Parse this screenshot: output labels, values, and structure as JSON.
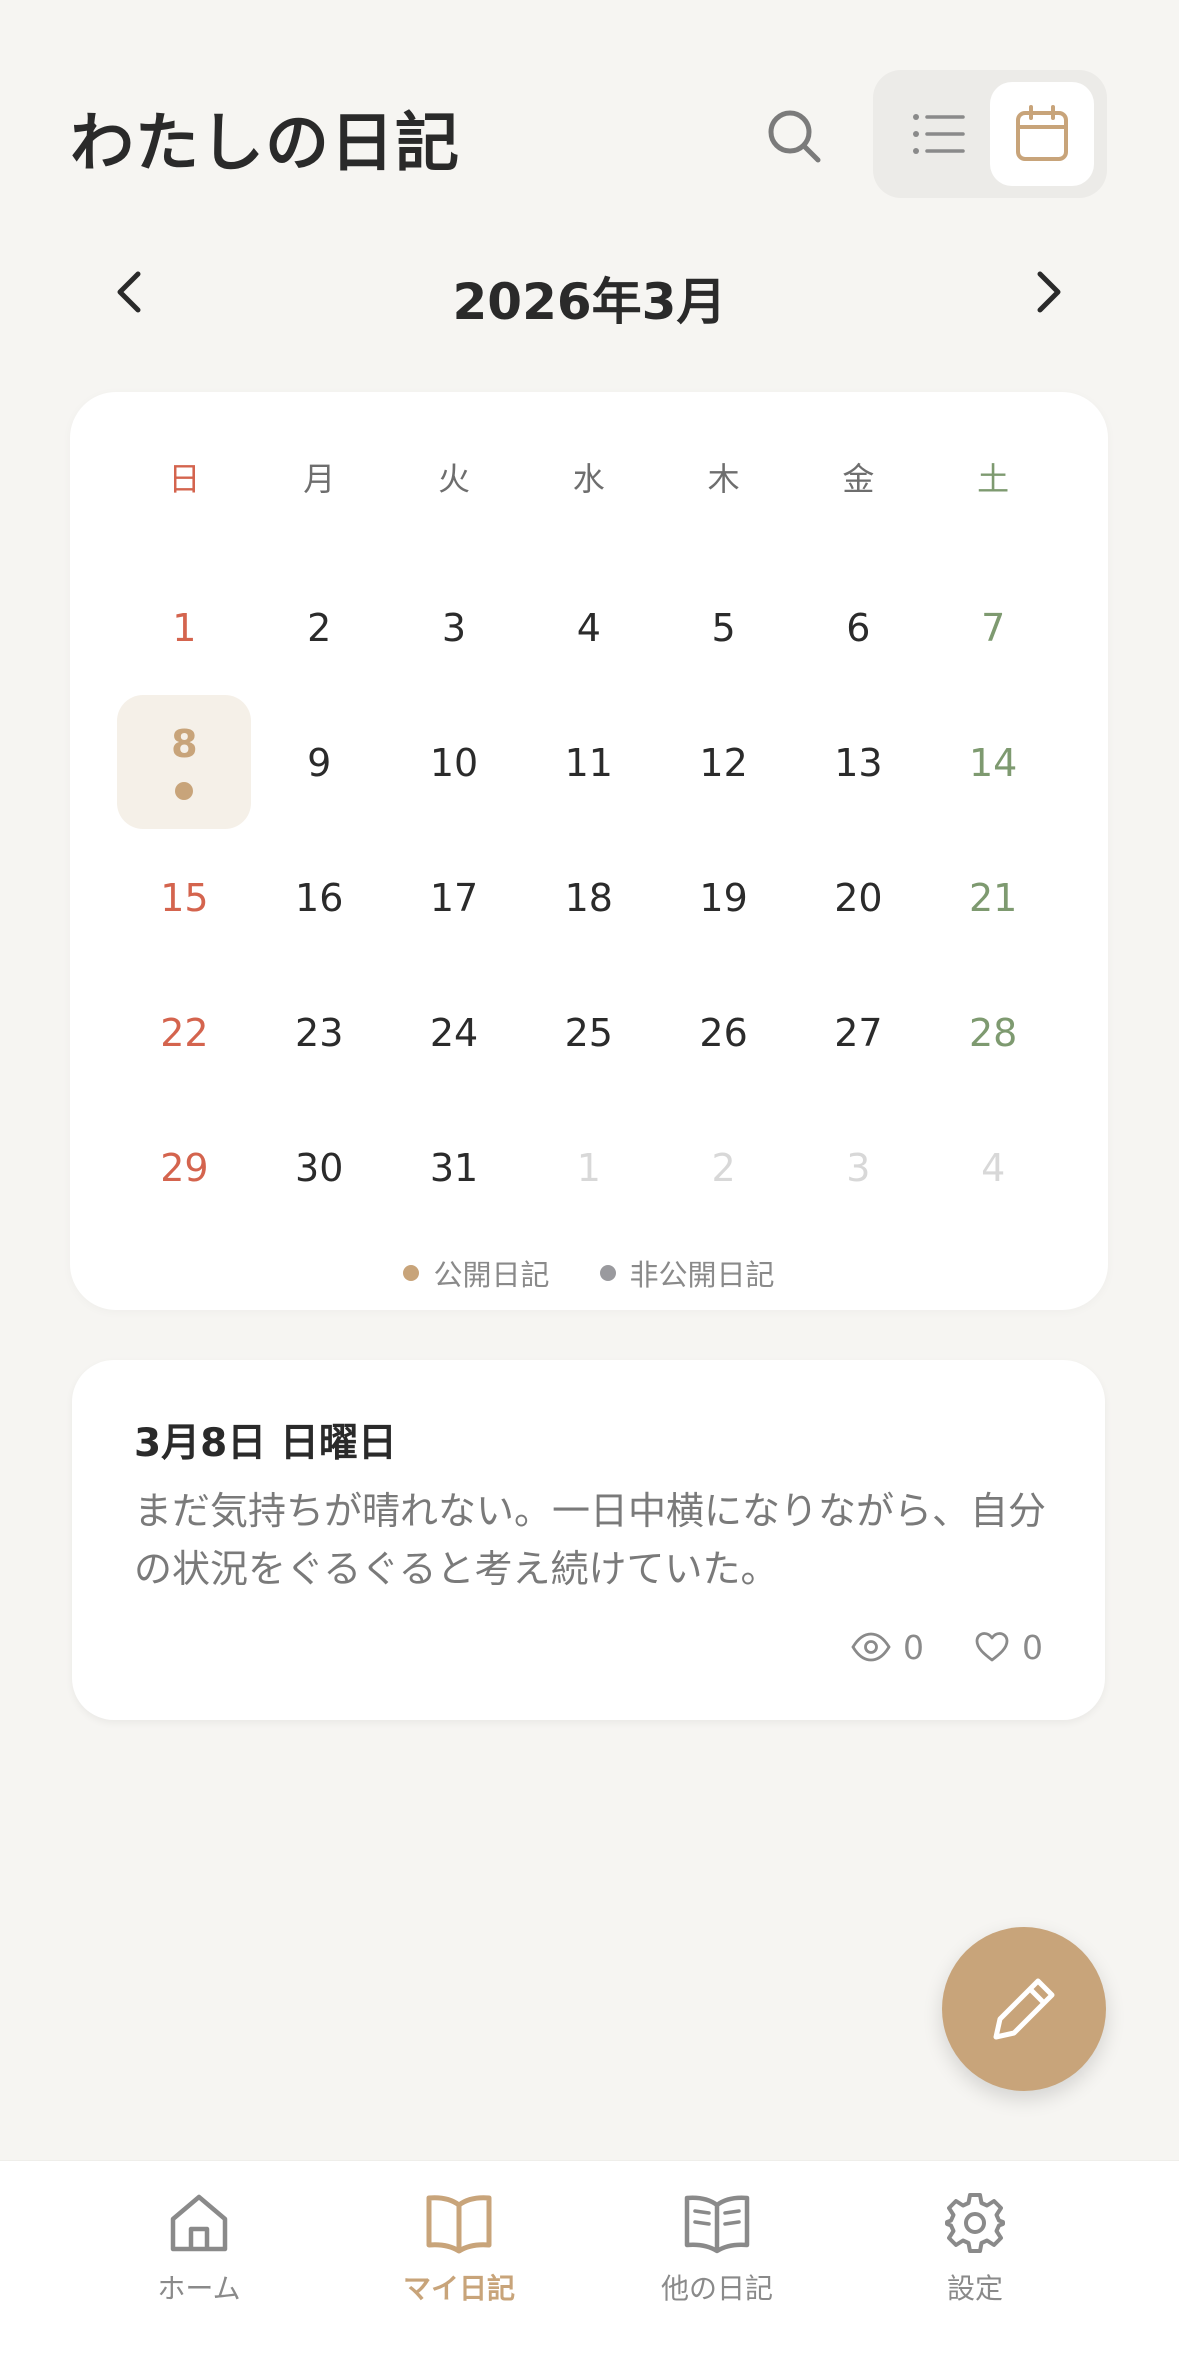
{
  "header": {
    "title": "わたしの日記",
    "search_icon": "search-icon",
    "view_toggle": {
      "list_icon": "list-icon",
      "calendar_icon": "calendar-icon",
      "active": "calendar"
    }
  },
  "month_nav": {
    "label": "2026年3月",
    "prev_icon": "chevron-left-icon",
    "next_icon": "chevron-right-icon"
  },
  "calendar": {
    "weekdays": [
      "日",
      "月",
      "火",
      "水",
      "木",
      "金",
      "土"
    ],
    "weeks": [
      [
        "1",
        "2",
        "3",
        "4",
        "5",
        "6",
        "7"
      ],
      [
        "8",
        "9",
        "10",
        "11",
        "12",
        "13",
        "14"
      ],
      [
        "15",
        "16",
        "17",
        "18",
        "19",
        "20",
        "21"
      ],
      [
        "22",
        "23",
        "24",
        "25",
        "26",
        "27",
        "28"
      ],
      [
        "29",
        "30",
        "31",
        "1",
        "2",
        "3",
        "4"
      ]
    ],
    "selected_day": "8",
    "days_with_public_entries": [
      "8"
    ],
    "legend": {
      "public_label": "公開日記",
      "private_label": "非公開日記"
    }
  },
  "entry": {
    "date": "3月8日 日曜日",
    "text": "まだ気持ちが晴れない。一日中横になりながら、自分の状況をぐるぐると考え続けていた。",
    "views": "0",
    "likes": "0"
  },
  "fab": {
    "icon": "pencil-icon"
  },
  "bottom_nav": {
    "items": [
      {
        "label": "ホーム",
        "icon": "home-icon"
      },
      {
        "label": "マイ日記",
        "icon": "book-open-icon"
      },
      {
        "label": "他の日記",
        "icon": "book-open-lines-icon"
      },
      {
        "label": "設定",
        "icon": "gear-icon"
      }
    ],
    "active_index": 1
  },
  "colors": {
    "accent": "#C8A47A",
    "background": "#F6F5F2",
    "sunday": "#D4644E",
    "saturday": "#7E9A70",
    "public_dot": "#C8A47A",
    "private_dot": "#9A9A9E",
    "other_month": "#D8D8D8"
  }
}
